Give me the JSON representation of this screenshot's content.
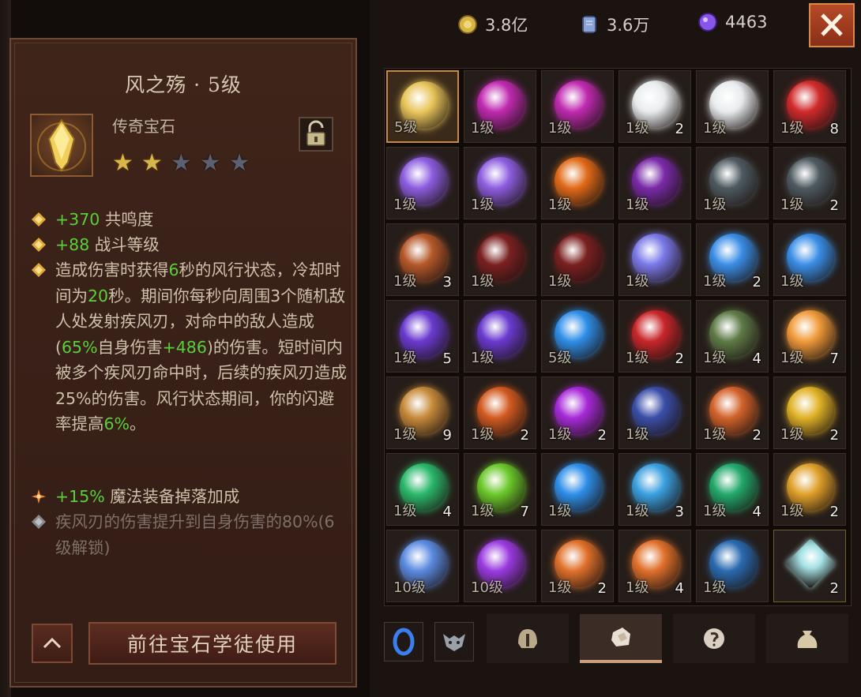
{
  "detail": {
    "title": "风之殇 · 5级",
    "type": "传奇宝石",
    "stars": {
      "filled": 2,
      "total": 5
    },
    "lock_icon": "unlocked-padlock-icon",
    "stats": [
      {
        "value": "+370",
        "label": " 共鸣度"
      },
      {
        "value": "+88",
        "label": " 战斗等级"
      }
    ],
    "effect": {
      "p1": "造成伤害时获得",
      "n1": "6",
      "p2": "秒的风行状态，冷却时间为",
      "n2": "20",
      "p3": "秒。期间你每秒向周围3个随机敌人处发射疾风刃，对命中的敌人造成(",
      "n3": "65%",
      "p4": "自身伤害",
      "n4": "+486",
      "p5": ")的伤害。短时间内被多个疾风刃命中时，后续的疾风刃造成25%的伤害。风行状态期间，你的闪避率提高",
      "n5": "6%",
      "p6": "。"
    },
    "magic_find": {
      "value": "+15%",
      "label": " 魔法装备掉落加成"
    },
    "locked_effect": "疾风刃的伤害提升到自身伤害的80%(6级解锁)",
    "use_button": "前往宝石学徒使用"
  },
  "currencies": [
    {
      "icon": "gold-coin-icon",
      "value": "3.8亿",
      "color": "#d7b545"
    },
    {
      "icon": "scroll-card-icon",
      "value": "3.6万",
      "color": "#8aa4d8"
    },
    {
      "icon": "purple-orb-icon",
      "value": "4463",
      "color": "#8a56e8"
    }
  ],
  "gems": [
    {
      "level": "5级",
      "count": "",
      "color": "#e8c45a",
      "selected": true
    },
    {
      "level": "1级",
      "count": "",
      "color": "#c02ab0"
    },
    {
      "level": "1级",
      "count": "",
      "color": "#c02ab0"
    },
    {
      "level": "1级",
      "count": "2",
      "color": "#e9ecee"
    },
    {
      "level": "1级",
      "count": "",
      "color": "#e9ecee"
    },
    {
      "level": "1级",
      "count": "8",
      "color": "#d12a2a"
    },
    {
      "level": "1级",
      "count": "",
      "color": "#8d5de0"
    },
    {
      "level": "1级",
      "count": "",
      "color": "#8d5de0"
    },
    {
      "level": "1级",
      "count": "",
      "color": "#e06a18"
    },
    {
      "level": "1级",
      "count": "",
      "color": "#7a2aa8"
    },
    {
      "level": "1级",
      "count": "",
      "color": "#4e5a60"
    },
    {
      "level": "1级",
      "count": "2",
      "color": "#4e5a60"
    },
    {
      "level": "1级",
      "count": "3",
      "color": "#b5582a"
    },
    {
      "level": "1级",
      "count": "",
      "color": "#7a2020"
    },
    {
      "level": "1级",
      "count": "",
      "color": "#7a2020"
    },
    {
      "level": "1级",
      "count": "",
      "color": "#7a78e8"
    },
    {
      "level": "1级",
      "count": "2",
      "color": "#3a8ee6"
    },
    {
      "level": "1级",
      "count": "",
      "color": "#3a8ee6"
    },
    {
      "level": "1级",
      "count": "5",
      "color": "#6a3ad0"
    },
    {
      "level": "1级",
      "count": "",
      "color": "#6a3ad0"
    },
    {
      "level": "5级",
      "count": "",
      "color": "#2e8ee8"
    },
    {
      "level": "1级",
      "count": "2",
      "color": "#c8262a"
    },
    {
      "level": "1级",
      "count": "4",
      "color": "#5e7a46"
    },
    {
      "level": "1级",
      "count": "7",
      "color": "#f09a3a"
    },
    {
      "level": "1级",
      "count": "9",
      "color": "#c78a3a"
    },
    {
      "level": "1级",
      "count": "2",
      "color": "#d25a20"
    },
    {
      "level": "1级",
      "count": "2",
      "color": "#a62ad8"
    },
    {
      "level": "1级",
      "count": "",
      "color": "#3a4ea8"
    },
    {
      "level": "1级",
      "count": "2",
      "color": "#d2622a"
    },
    {
      "level": "1级",
      "count": "2",
      "color": "#e0b226"
    },
    {
      "level": "1级",
      "count": "4",
      "color": "#2ab86a"
    },
    {
      "level": "1级",
      "count": "7",
      "color": "#6ac82a"
    },
    {
      "level": "1级",
      "count": "",
      "color": "#2e8ee8"
    },
    {
      "level": "1级",
      "count": "3",
      "color": "#3aa0e0"
    },
    {
      "level": "1级",
      "count": "4",
      "color": "#22a86a"
    },
    {
      "level": "1级",
      "count": "2",
      "color": "#e0a02a"
    },
    {
      "level": "10级",
      "count": "",
      "color": "#5a8ae0"
    },
    {
      "level": "10级",
      "count": "",
      "color": "#9a3ae0"
    },
    {
      "level": "1级",
      "count": "2",
      "color": "#e0702a"
    },
    {
      "level": "1级",
      "count": "4",
      "color": "#e0702a"
    },
    {
      "level": "1级",
      "count": "",
      "color": "#2a6ab0"
    },
    {
      "level": "",
      "count": "2",
      "color": "#a6e2e6",
      "gold": true
    }
  ],
  "tabs": [
    {
      "name": "tab-blue-orb",
      "icon": "blue-orb-icon",
      "active": false
    },
    {
      "name": "tab-demon-mask",
      "icon": "demon-mask-icon",
      "active": false
    },
    {
      "name": "tab-helmet",
      "icon": "helmet-icon",
      "active": false
    },
    {
      "name": "tab-gems",
      "icon": "gem-pouch-icon",
      "active": true
    },
    {
      "name": "tab-rune",
      "icon": "rune-icon",
      "active": false
    },
    {
      "name": "tab-bag",
      "icon": "bag-icon",
      "active": false
    }
  ]
}
